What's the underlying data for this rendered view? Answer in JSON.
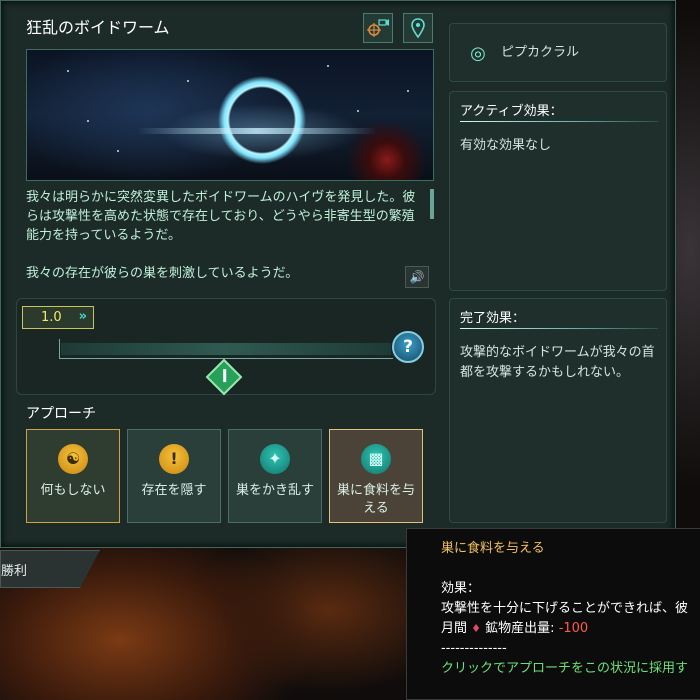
{
  "event": {
    "title": "狂乱のボイドワーム",
    "description_1": "我々は明らかに突然変異したボイドワームのハイヴを発見した。彼らは攻撃性を高めた状態で存在しており、どうやら非寄生型の繁殖能力を持っているようだ。",
    "description_2": "我々の存在が彼らの巣を刺激しているようだ。"
  },
  "slider": {
    "speed_value": "1.0",
    "help_label": "?"
  },
  "approach": {
    "label": "アプローチ",
    "options": [
      {
        "label": "何もしない",
        "icon": "hands-icon"
      },
      {
        "label": "存在を隠す",
        "icon": "exclamation-icon"
      },
      {
        "label": "巣をかき乱す",
        "icon": "strike-icon"
      },
      {
        "label": "巣に食料を与える",
        "icon": "gift-icon"
      }
    ]
  },
  "right": {
    "system_name": "ピプカクラル",
    "active_header": "アクティブ効果：",
    "active_body": "有効な効果なし",
    "complete_header": "完了効果：",
    "complete_body": "攻撃的なボイドワームが我々の首都を攻撃するかもしれない。"
  },
  "victory_tab": "勝利",
  "tooltip": {
    "title": "巣に食料を与える",
    "effect_header": "効果：",
    "line2": "攻撃性を十分に下げることができれば、彼",
    "line3_prefix": "月間",
    "line3_label": "鉱物産出量:",
    "line3_value": "-100",
    "separator": "--------------",
    "hint": "クリックでアプローチをこの状況に採用す"
  },
  "colors": {
    "accent_teal": "#48d8d0",
    "gold_border": "#d2a03e",
    "negative": "#ff5a4a",
    "hint_green": "#6ee07a",
    "tooltip_title": "#f0c060"
  }
}
